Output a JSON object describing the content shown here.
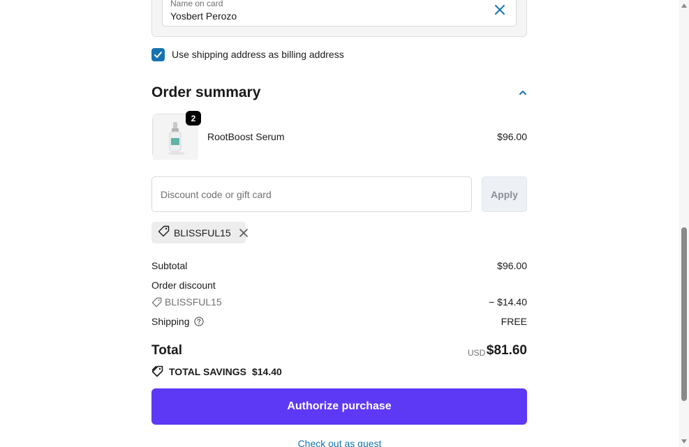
{
  "payment": {
    "name_label": "Name on card",
    "name_value": "Yosbert Perozo",
    "billing_checkbox_label": "Use shipping address as billing address",
    "billing_checked": true
  },
  "summary": {
    "title": "Order summary",
    "product": {
      "name": "RootBoost Serum",
      "price": "$96.00",
      "quantity": "2"
    },
    "discount": {
      "placeholder": "Discount code or gift card",
      "apply_label": "Apply",
      "applied_code": "BLISSFUL15"
    },
    "lines": {
      "subtotal_label": "Subtotal",
      "subtotal_value": "$96.00",
      "order_discount_label": "Order discount",
      "discount_code": "BLISSFUL15",
      "discount_value": "− $14.40",
      "shipping_label": "Shipping",
      "shipping_value": "FREE"
    },
    "total": {
      "label": "Total",
      "currency": "USD",
      "amount": "$81.60"
    },
    "savings": {
      "label": "TOTAL SAVINGS",
      "amount": "$14.40"
    }
  },
  "actions": {
    "authorize_label": "Authorize purchase",
    "guest_link": "Check out as guest"
  },
  "colors": {
    "accent": "#5d39f5",
    "link": "#1773b0",
    "checkbox": "#1773b0"
  }
}
